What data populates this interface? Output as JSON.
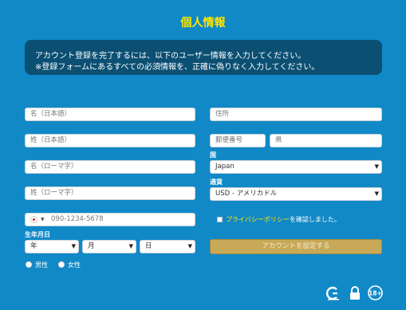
{
  "header": {
    "title": "個人情報"
  },
  "notice": {
    "line1": "アカウント登録を完了するには、以下のユーザー情報を入力してください。",
    "line2": "※登録フォームにあるすべての必須情報を、正確に偽りなく入力してください。"
  },
  "form": {
    "first_name_jp": {
      "placeholder": "名（日本語）"
    },
    "last_name_jp": {
      "placeholder": "姓（日本語）"
    },
    "first_name_roman": {
      "placeholder": "名（ローマ字）"
    },
    "last_name_roman": {
      "placeholder": "姓（ローマ字）"
    },
    "phone": {
      "placeholder": "090-1234-5678"
    },
    "birthdate": {
      "label": "生年月日",
      "year": "年",
      "month": "月",
      "day": "日"
    },
    "gender": {
      "male": "男性",
      "female": "女性"
    },
    "address": {
      "placeholder": "住所"
    },
    "postal_code": {
      "placeholder": "郵便番号"
    },
    "prefecture": {
      "placeholder": "県"
    },
    "country": {
      "label": "国",
      "value": "Japan"
    },
    "currency": {
      "label": "通貨",
      "value": "USD - アメリカドル"
    },
    "privacy": {
      "link": "プライバシーポリシー",
      "suffix": "を確認しました。"
    },
    "submit_label": "アカウントを設定する"
  },
  "footer": {
    "age_badge": "18+"
  },
  "colors": {
    "background": "#1189c7",
    "title": "#ffe600",
    "notice_bg": "#0b4f73",
    "submit_bg": "#c7a958"
  }
}
